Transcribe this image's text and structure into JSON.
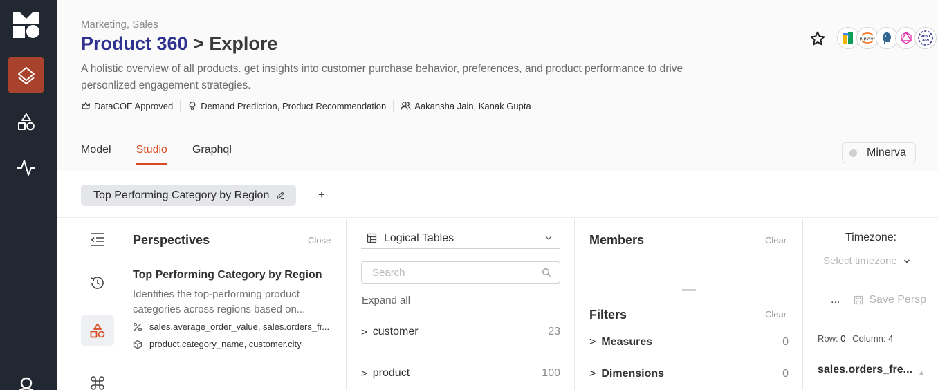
{
  "nav": {
    "items": [
      {
        "name": "layers",
        "active": true
      },
      {
        "name": "shapes",
        "active": false
      },
      {
        "name": "activity",
        "active": false
      },
      {
        "name": "user",
        "active": false
      }
    ]
  },
  "header": {
    "breadcrumb": "Marketing, Sales",
    "title": "Product 360",
    "subtitle": "> Explore",
    "description": "A holistic overview of all products. get insights into customer purchase behavior, preferences, and product performance to drive personlized engagement strategies.",
    "meta": {
      "approval": "DataCOE Approved",
      "use_cases": "Demand Prediction, Product Recommendation",
      "owners": "Aakansha Jain, Kanak Gupta"
    },
    "integrations": [
      "bigquery",
      "jupyter",
      "postgres",
      "graphql",
      "REST API"
    ]
  },
  "tabs": [
    {
      "label": "Model",
      "active": false
    },
    {
      "label": "Studio",
      "active": true
    },
    {
      "label": "Graphql",
      "active": false
    }
  ],
  "minerva": {
    "label": "Minerva"
  },
  "perspective_chip": {
    "label": "Top Performing Category by Region"
  },
  "perspectives": {
    "title": "Perspectives",
    "close_label": "Close",
    "item": {
      "title": "Top Performing Category by Region",
      "description": "Identifies the top-performing product categories across regions based on...",
      "measures": "sales.average_order_value, sales.orders_fr...",
      "dimensions": "product.category_name, customer.city"
    }
  },
  "logical_tables": {
    "selector_label": "Logical Tables",
    "search_placeholder": "Search",
    "expand_all": "Expand all",
    "tables": [
      {
        "name": "customer",
        "count": "23"
      },
      {
        "name": "product",
        "count": "100"
      }
    ]
  },
  "members": {
    "title": "Members",
    "clear_label": "Clear"
  },
  "filters": {
    "title": "Filters",
    "clear_label": "Clear",
    "groups": [
      {
        "name": "Measures",
        "count": "0"
      },
      {
        "name": "Dimensions",
        "count": "0"
      }
    ]
  },
  "results": {
    "timezone_label": "Timezone:",
    "timezone_placeholder": "Select timezone",
    "more_label": "...",
    "save_label": "Save Persp",
    "row_label": "Row:",
    "row_value": "0",
    "column_label": "Column:",
    "column_value": "4",
    "column_header": "sales.orders_fre..."
  }
}
